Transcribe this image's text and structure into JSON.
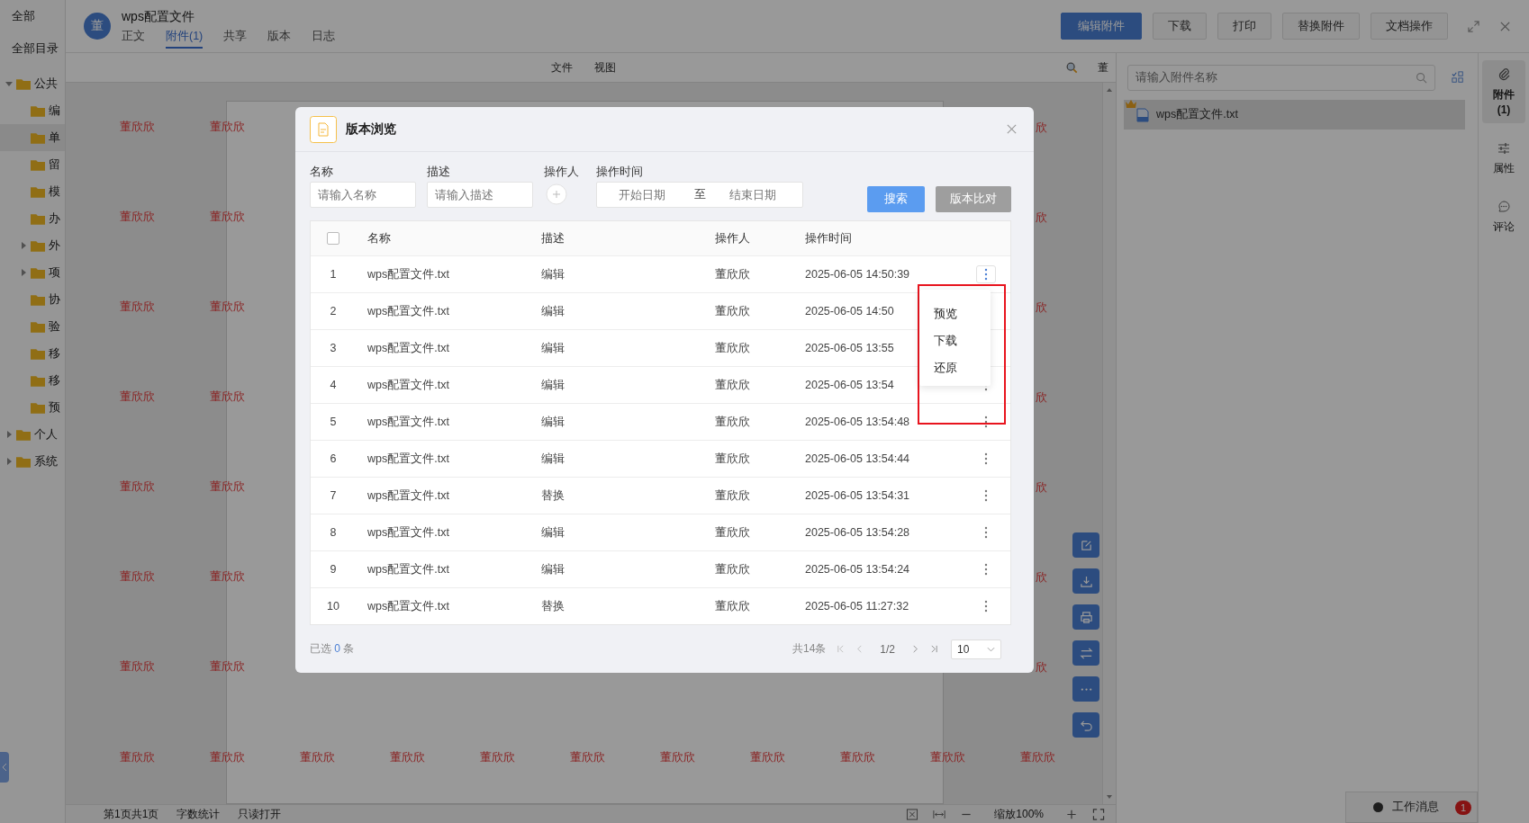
{
  "sidebar": {
    "top_items": [
      {
        "label": "全部"
      },
      {
        "label": "全部目录"
      }
    ],
    "tree": [
      {
        "label": "公共",
        "expanded": true,
        "selected": false,
        "children": [
          {
            "label": "编",
            "selected": false
          },
          {
            "label": "单",
            "selected": true
          },
          {
            "label": "留",
            "selected": false
          },
          {
            "label": "模",
            "selected": false
          },
          {
            "label": "办",
            "selected": false
          },
          {
            "label": "外",
            "selected": false,
            "expanded": false
          },
          {
            "label": "项",
            "selected": false,
            "expanded": false
          },
          {
            "label": "协",
            "selected": false
          },
          {
            "label": "验",
            "selected": false
          },
          {
            "label": "移",
            "selected": false
          },
          {
            "label": "移",
            "selected": false
          },
          {
            "label": "预",
            "selected": false
          }
        ]
      },
      {
        "label": "个人",
        "expanded": false,
        "selected": false
      },
      {
        "label": "系统",
        "expanded": false,
        "selected": false
      }
    ]
  },
  "header": {
    "avatar": "董",
    "title": "wps配置文件",
    "tabs": [
      {
        "label": "正文",
        "selected": false
      },
      {
        "label": "附件(1)",
        "selected": true
      },
      {
        "label": "共享",
        "selected": false
      },
      {
        "label": "版本",
        "selected": false
      },
      {
        "label": "日志",
        "selected": false
      }
    ],
    "buttons": [
      {
        "label": "编辑附件",
        "primary": true
      },
      {
        "label": "下载",
        "primary": false
      },
      {
        "label": "打印",
        "primary": false
      },
      {
        "label": "替换附件",
        "primary": false
      },
      {
        "label": "文档操作",
        "primary": false
      }
    ]
  },
  "toolbar": {
    "menus": [
      "文件",
      "视图"
    ],
    "user_mark": "董"
  },
  "watermark": {
    "left_rows": [
      [
        "董欣欣",
        "董欣欣"
      ],
      [
        "董欣欣",
        "董欣欣"
      ],
      [
        "董欣欣",
        "董欣欣"
      ],
      [
        "董欣欣",
        "董欣欣"
      ],
      [
        "董欣欣",
        "董欣欣"
      ],
      [
        "董欣欣",
        "董欣欣"
      ],
      [
        "董欣欣",
        "董欣欣"
      ]
    ],
    "edge": [
      "欣",
      "欣",
      "欣",
      "欣",
      "欣",
      "欣",
      "欣"
    ],
    "bottom": [
      "董欣欣",
      "董欣欣",
      "董欣欣",
      "董欣欣",
      "董欣欣",
      "董欣欣",
      "董欣欣",
      "董欣欣",
      "董欣欣",
      "董欣欣",
      "董欣欣"
    ]
  },
  "status_bar": {
    "items": [
      "第1页共1页",
      "字数统计",
      "只读打开"
    ],
    "zoom": "缩放100%"
  },
  "right_panel": {
    "search": {
      "placeholder": "请输入附件名称"
    },
    "files": [
      {
        "name": "wps配置文件.txt",
        "starred": true,
        "selected": true
      }
    ]
  },
  "rail": [
    {
      "kind": "attachment",
      "label": "附件",
      "count": "(1)",
      "selected": true
    },
    {
      "kind": "properties",
      "label": "属性",
      "selected": false
    },
    {
      "kind": "comment",
      "label": "评论",
      "selected": false
    }
  ],
  "work_message": {
    "label": "工作消息",
    "badge": "1"
  },
  "modal": {
    "title": "版本浏览",
    "filters": {
      "name": {
        "label": "名称",
        "placeholder": "请输入名称"
      },
      "desc": {
        "label": "描述",
        "placeholder": "请输入描述"
      },
      "operator": {
        "label": "操作人"
      },
      "time": {
        "label": "操作时间",
        "start_placeholder": "开始日期",
        "separator": "至",
        "end_placeholder": "结束日期"
      }
    },
    "buttons": [
      {
        "label": "搜索",
        "disabled": false
      },
      {
        "label": "版本比对",
        "disabled": true
      }
    ],
    "table": {
      "select_all": {
        "checked": false
      },
      "columns": [
        "名称",
        "描述",
        "操作人",
        "操作时间"
      ],
      "rows": [
        {
          "index": "1",
          "name": "wps配置文件.txt",
          "desc": "编辑",
          "operator": "董欣欣",
          "time": "2025-06-05 14:50:39",
          "menu_open": true
        },
        {
          "index": "2",
          "name": "wps配置文件.txt",
          "desc": "编辑",
          "operator": "董欣欣",
          "time": "2025-06-05 14:50",
          "menu_open": false
        },
        {
          "index": "3",
          "name": "wps配置文件.txt",
          "desc": "编辑",
          "operator": "董欣欣",
          "time": "2025-06-05 13:55",
          "menu_open": false
        },
        {
          "index": "4",
          "name": "wps配置文件.txt",
          "desc": "编辑",
          "operator": "董欣欣",
          "time": "2025-06-05 13:54",
          "menu_open": false
        },
        {
          "index": "5",
          "name": "wps配置文件.txt",
          "desc": "编辑",
          "operator": "董欣欣",
          "time": "2025-06-05 13:54:48",
          "menu_open": false
        },
        {
          "index": "6",
          "name": "wps配置文件.txt",
          "desc": "编辑",
          "operator": "董欣欣",
          "time": "2025-06-05 13:54:44",
          "menu_open": false
        },
        {
          "index": "7",
          "name": "wps配置文件.txt",
          "desc": "替换",
          "operator": "董欣欣",
          "time": "2025-06-05 13:54:31",
          "menu_open": false
        },
        {
          "index": "8",
          "name": "wps配置文件.txt",
          "desc": "编辑",
          "operator": "董欣欣",
          "time": "2025-06-05 13:54:28",
          "menu_open": false
        },
        {
          "index": "9",
          "name": "wps配置文件.txt",
          "desc": "编辑",
          "operator": "董欣欣",
          "time": "2025-06-05 13:54:24",
          "menu_open": false
        },
        {
          "index": "10",
          "name": "wps配置文件.txt",
          "desc": "替换",
          "operator": "董欣欣",
          "time": "2025-06-05 11:27:32",
          "menu_open": false
        }
      ]
    },
    "menu": [
      "预览",
      "下载",
      "还原"
    ],
    "footer": {
      "selected_label": "已选",
      "selected_count": "0",
      "unit": "条",
      "total": "共14条",
      "page": "1/2",
      "page_size": "10"
    }
  }
}
